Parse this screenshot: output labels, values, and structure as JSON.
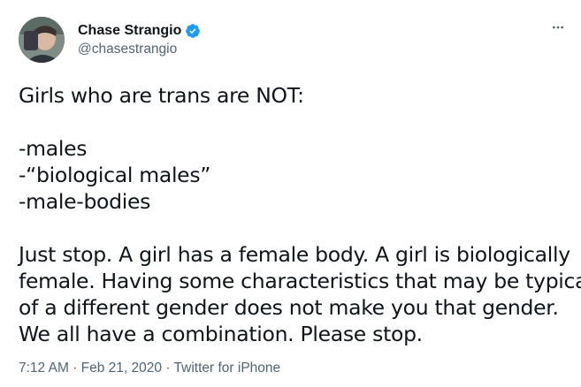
{
  "author": {
    "display_name": "Chase Strangio",
    "handle": "@chasestrangio",
    "verified": true,
    "avatar_icon": "profile-photo",
    "verified_color": "#1d9bf0"
  },
  "more_icon": "more-horizontal-icon",
  "body_lines": [
    "Girls who are trans are NOT:",
    "",
    "-males",
    "-“biological males”",
    "-male-bodies",
    "",
    "Just stop. A girl has a female body. A girl is biologically",
    "female. Having some characteristics that may be typical",
    "of a different gender does not make you that gender.",
    "We all have a combination. Please stop."
  ],
  "meta": {
    "time": "7:12 AM",
    "date": "Feb 21, 2020",
    "source": "Twitter for iPhone",
    "separator": "·"
  }
}
